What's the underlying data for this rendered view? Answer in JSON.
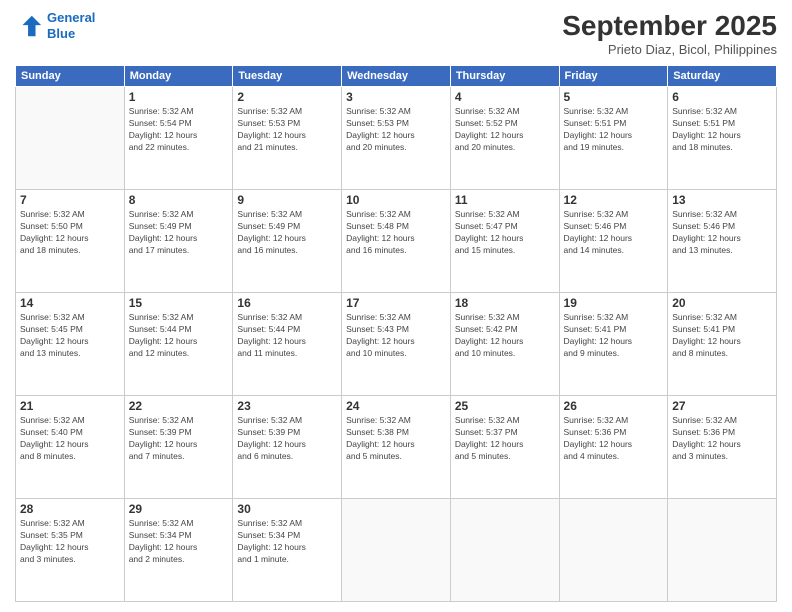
{
  "header": {
    "logo_line1": "General",
    "logo_line2": "Blue",
    "month": "September 2025",
    "location": "Prieto Diaz, Bicol, Philippines"
  },
  "days_of_week": [
    "Sunday",
    "Monday",
    "Tuesday",
    "Wednesday",
    "Thursday",
    "Friday",
    "Saturday"
  ],
  "weeks": [
    [
      {
        "day": "",
        "info": ""
      },
      {
        "day": "1",
        "info": "Sunrise: 5:32 AM\nSunset: 5:54 PM\nDaylight: 12 hours\nand 22 minutes."
      },
      {
        "day": "2",
        "info": "Sunrise: 5:32 AM\nSunset: 5:53 PM\nDaylight: 12 hours\nand 21 minutes."
      },
      {
        "day": "3",
        "info": "Sunrise: 5:32 AM\nSunset: 5:53 PM\nDaylight: 12 hours\nand 20 minutes."
      },
      {
        "day": "4",
        "info": "Sunrise: 5:32 AM\nSunset: 5:52 PM\nDaylight: 12 hours\nand 20 minutes."
      },
      {
        "day": "5",
        "info": "Sunrise: 5:32 AM\nSunset: 5:51 PM\nDaylight: 12 hours\nand 19 minutes."
      },
      {
        "day": "6",
        "info": "Sunrise: 5:32 AM\nSunset: 5:51 PM\nDaylight: 12 hours\nand 18 minutes."
      }
    ],
    [
      {
        "day": "7",
        "info": "Sunrise: 5:32 AM\nSunset: 5:50 PM\nDaylight: 12 hours\nand 18 minutes."
      },
      {
        "day": "8",
        "info": "Sunrise: 5:32 AM\nSunset: 5:49 PM\nDaylight: 12 hours\nand 17 minutes."
      },
      {
        "day": "9",
        "info": "Sunrise: 5:32 AM\nSunset: 5:49 PM\nDaylight: 12 hours\nand 16 minutes."
      },
      {
        "day": "10",
        "info": "Sunrise: 5:32 AM\nSunset: 5:48 PM\nDaylight: 12 hours\nand 16 minutes."
      },
      {
        "day": "11",
        "info": "Sunrise: 5:32 AM\nSunset: 5:47 PM\nDaylight: 12 hours\nand 15 minutes."
      },
      {
        "day": "12",
        "info": "Sunrise: 5:32 AM\nSunset: 5:46 PM\nDaylight: 12 hours\nand 14 minutes."
      },
      {
        "day": "13",
        "info": "Sunrise: 5:32 AM\nSunset: 5:46 PM\nDaylight: 12 hours\nand 13 minutes."
      }
    ],
    [
      {
        "day": "14",
        "info": "Sunrise: 5:32 AM\nSunset: 5:45 PM\nDaylight: 12 hours\nand 13 minutes."
      },
      {
        "day": "15",
        "info": "Sunrise: 5:32 AM\nSunset: 5:44 PM\nDaylight: 12 hours\nand 12 minutes."
      },
      {
        "day": "16",
        "info": "Sunrise: 5:32 AM\nSunset: 5:44 PM\nDaylight: 12 hours\nand 11 minutes."
      },
      {
        "day": "17",
        "info": "Sunrise: 5:32 AM\nSunset: 5:43 PM\nDaylight: 12 hours\nand 10 minutes."
      },
      {
        "day": "18",
        "info": "Sunrise: 5:32 AM\nSunset: 5:42 PM\nDaylight: 12 hours\nand 10 minutes."
      },
      {
        "day": "19",
        "info": "Sunrise: 5:32 AM\nSunset: 5:41 PM\nDaylight: 12 hours\nand 9 minutes."
      },
      {
        "day": "20",
        "info": "Sunrise: 5:32 AM\nSunset: 5:41 PM\nDaylight: 12 hours\nand 8 minutes."
      }
    ],
    [
      {
        "day": "21",
        "info": "Sunrise: 5:32 AM\nSunset: 5:40 PM\nDaylight: 12 hours\nand 8 minutes."
      },
      {
        "day": "22",
        "info": "Sunrise: 5:32 AM\nSunset: 5:39 PM\nDaylight: 12 hours\nand 7 minutes."
      },
      {
        "day": "23",
        "info": "Sunrise: 5:32 AM\nSunset: 5:39 PM\nDaylight: 12 hours\nand 6 minutes."
      },
      {
        "day": "24",
        "info": "Sunrise: 5:32 AM\nSunset: 5:38 PM\nDaylight: 12 hours\nand 5 minutes."
      },
      {
        "day": "25",
        "info": "Sunrise: 5:32 AM\nSunset: 5:37 PM\nDaylight: 12 hours\nand 5 minutes."
      },
      {
        "day": "26",
        "info": "Sunrise: 5:32 AM\nSunset: 5:36 PM\nDaylight: 12 hours\nand 4 minutes."
      },
      {
        "day": "27",
        "info": "Sunrise: 5:32 AM\nSunset: 5:36 PM\nDaylight: 12 hours\nand 3 minutes."
      }
    ],
    [
      {
        "day": "28",
        "info": "Sunrise: 5:32 AM\nSunset: 5:35 PM\nDaylight: 12 hours\nand 3 minutes."
      },
      {
        "day": "29",
        "info": "Sunrise: 5:32 AM\nSunset: 5:34 PM\nDaylight: 12 hours\nand 2 minutes."
      },
      {
        "day": "30",
        "info": "Sunrise: 5:32 AM\nSunset: 5:34 PM\nDaylight: 12 hours\nand 1 minute."
      },
      {
        "day": "",
        "info": ""
      },
      {
        "day": "",
        "info": ""
      },
      {
        "day": "",
        "info": ""
      },
      {
        "day": "",
        "info": ""
      }
    ]
  ]
}
